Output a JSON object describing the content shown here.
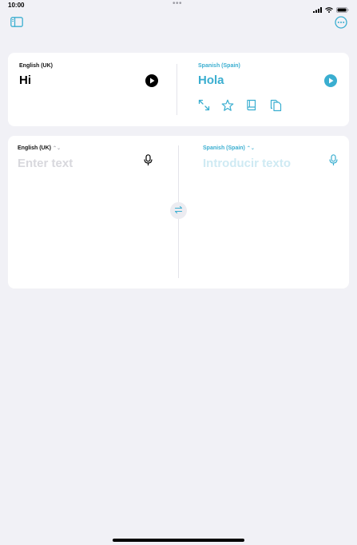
{
  "status_bar": {
    "time": "10:00",
    "dots": "•••",
    "signal_icon": "cellular-signal-icon",
    "wifi_icon": "wifi-icon",
    "battery_icon": "battery-icon"
  },
  "toolbar": {
    "sidebar_icon": "sidebar-icon",
    "more_icon": "ellipsis-circle-icon"
  },
  "result": {
    "source_language": "English (UK)",
    "source_text": "Hi",
    "target_language": "Spanish (Spain)",
    "target_text": "Hola",
    "actions": [
      "expand-icon",
      "star-icon",
      "book-icon",
      "copy-icon"
    ]
  },
  "input": {
    "source_language": "English (UK)",
    "source_placeholder": "Enter text",
    "target_language": "Spanish (Spain)",
    "target_placeholder": "Introducir texto",
    "chevron": "⌃⌄"
  },
  "colors": {
    "accent": "#3aaed0",
    "background": "#f1f1f6",
    "card": "#ffffff"
  }
}
